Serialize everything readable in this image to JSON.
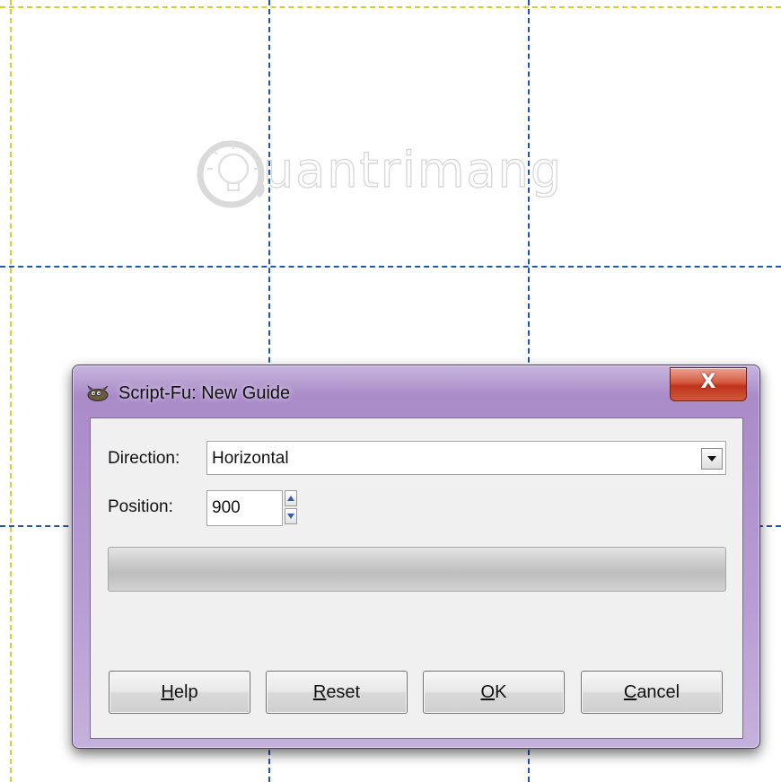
{
  "watermark": {
    "text": "uantrimang"
  },
  "dialog": {
    "title": "Script-Fu: New Guide",
    "close_label": "X",
    "direction": {
      "label": "Direction:",
      "value": "Horizontal"
    },
    "position": {
      "label": "Position:",
      "value": "900"
    },
    "buttons": {
      "help": {
        "key": "H",
        "rest": "elp"
      },
      "reset": {
        "key": "R",
        "rest": "eset"
      },
      "ok": {
        "key": "O",
        "rest": "K"
      },
      "cancel": {
        "key": "C",
        "rest": "ancel"
      }
    }
  },
  "colors": {
    "image_border": "#d6cf2e",
    "guide": "#1f56b3",
    "titlebar": "#b79cd3",
    "close_button": "#c0311a"
  },
  "icons": {
    "app_icon": "gimp-wilber-icon",
    "close_icon": "close-icon",
    "dropdown_icon": "chevron-down-icon",
    "stepper_icons": [
      "spin-up-icon",
      "spin-down-icon"
    ]
  }
}
